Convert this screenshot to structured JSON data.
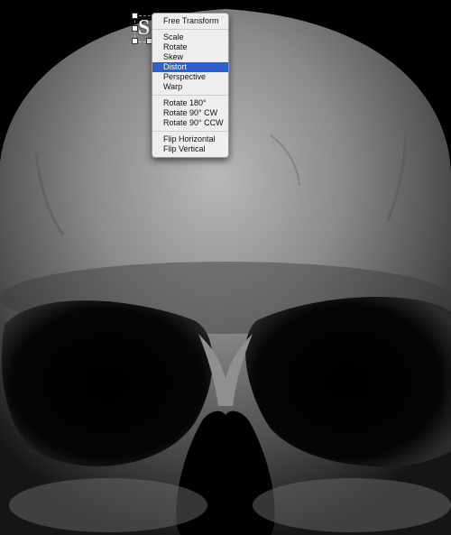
{
  "menu": {
    "title_item": "Free Transform",
    "groups": [
      [
        "Scale",
        "Rotate",
        "Skew",
        "Distort",
        "Perspective",
        "Warp"
      ],
      [
        "Rotate 180°",
        "Rotate 90° CW",
        "Rotate 90° CCW"
      ],
      [
        "Flip Horizontal",
        "Flip Vertical"
      ]
    ],
    "highlighted": "Distort"
  },
  "layer": {
    "glyph": "S"
  },
  "colors": {
    "highlight": "#2e60c9",
    "menu_bg": "#f0f0f0",
    "background": "#000000"
  }
}
